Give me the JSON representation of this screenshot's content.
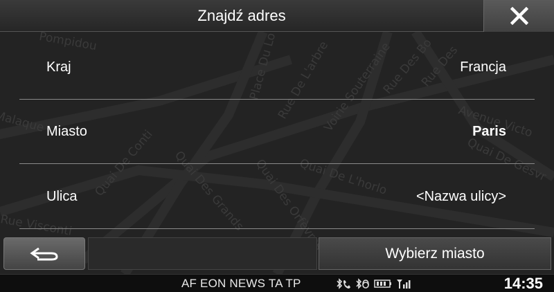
{
  "header": {
    "title": "Znajdź adres",
    "close_icon": "close-icon"
  },
  "map": {
    "street_labels": [
      "Pompidou",
      "Place Du Lo",
      "Rue De L'arbre",
      "Voirie Souterraine",
      "Rue Des Bo",
      "Rue Des",
      "Avenue Victo",
      "Quai De Gesvr",
      "Quai De Conti",
      "Quai Des Grands",
      "Quai Des Orfèvres",
      "Quai De L'horlo",
      "Rue Visconti",
      "Malaque"
    ]
  },
  "rows": [
    {
      "label": "Kraj",
      "value": "Francja"
    },
    {
      "label": "Miasto",
      "value": "Paris"
    },
    {
      "label": "Ulica",
      "value": "<Nazwa ulicy>"
    }
  ],
  "bottom": {
    "back_icon": "back-arrow-icon",
    "select_city": "Wybierz miasto"
  },
  "status": {
    "rds": "AF EON NEWS TA TP",
    "icons": [
      "bluetooth-phone-icon",
      "bluetooth-audio-icon",
      "battery-icon",
      "signal-icon"
    ],
    "clock": "14:35"
  },
  "colors": {
    "background": "#232323",
    "header": "#2e2e2e",
    "divider": "#8a8a8a"
  }
}
